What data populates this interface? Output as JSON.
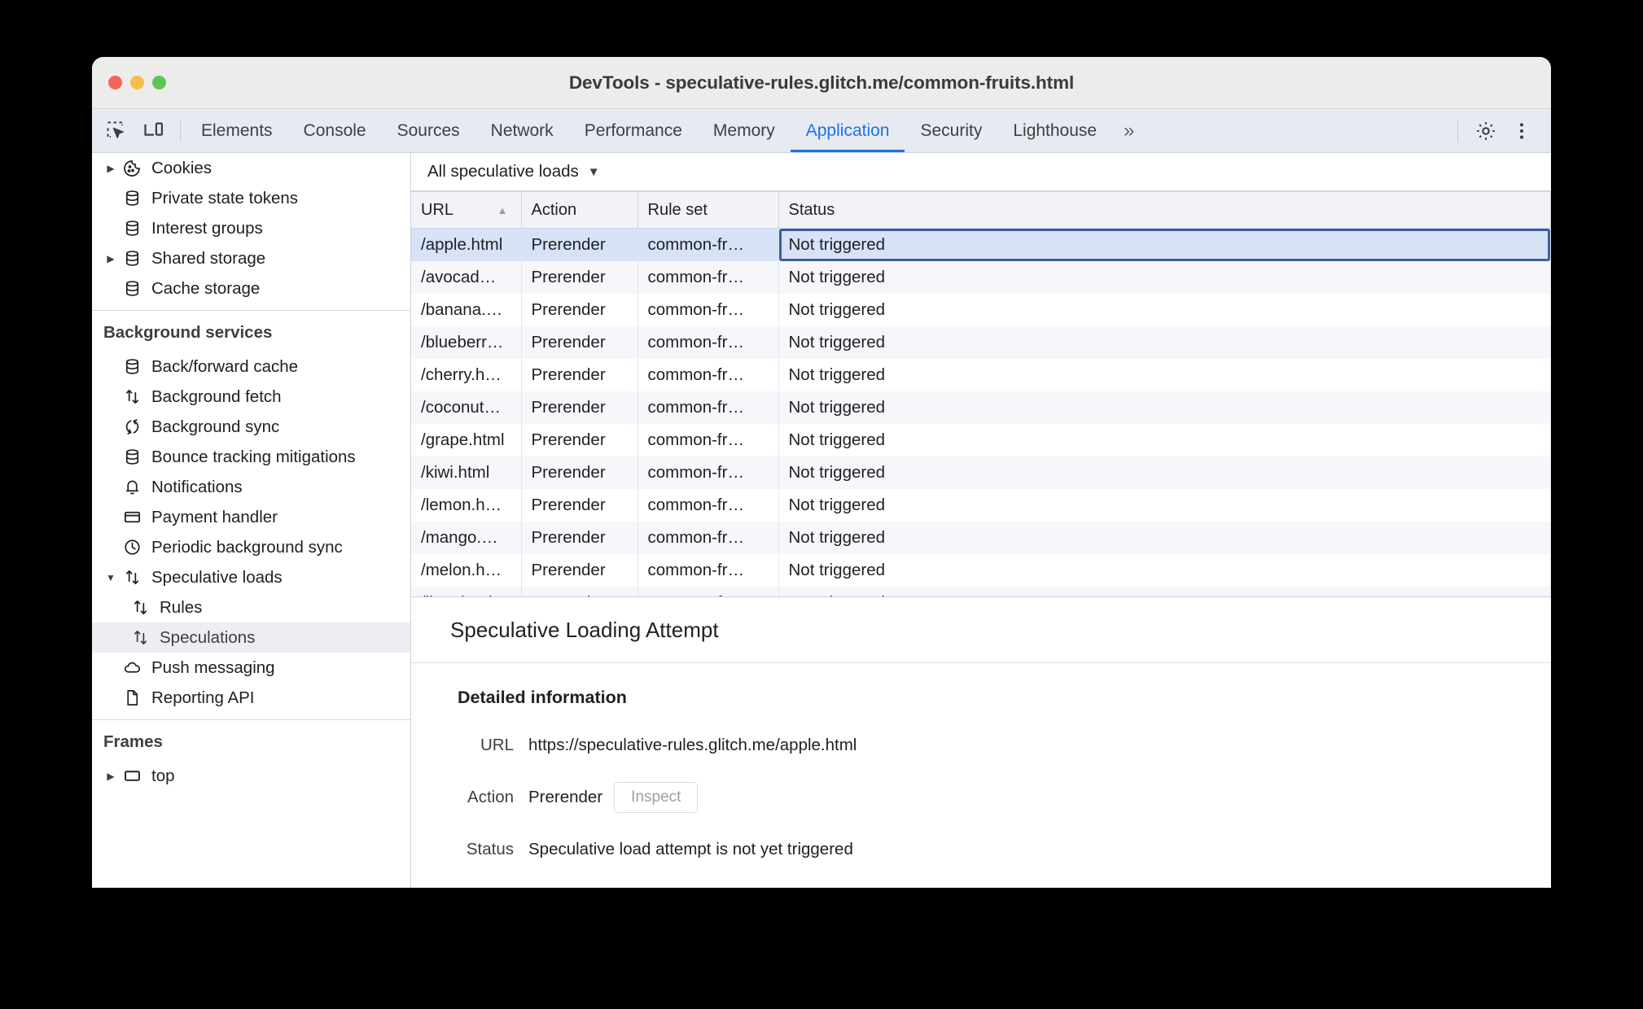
{
  "window": {
    "title": "DevTools - speculative-rules.glitch.me/common-fruits.html"
  },
  "toolbar": {
    "inspect_icon": "inspect-element-icon",
    "device_icon": "device-toolbar-icon",
    "settings_icon": "gear-icon",
    "more_icon": "more-vertical-icon",
    "overflow_label": "»"
  },
  "tabs": [
    {
      "label": "Elements",
      "active": false
    },
    {
      "label": "Console",
      "active": false
    },
    {
      "label": "Sources",
      "active": false
    },
    {
      "label": "Network",
      "active": false
    },
    {
      "label": "Performance",
      "active": false
    },
    {
      "label": "Memory",
      "active": false
    },
    {
      "label": "Application",
      "active": true
    },
    {
      "label": "Security",
      "active": false
    },
    {
      "label": "Lighthouse",
      "active": false
    }
  ],
  "sidebar": {
    "storage_items": [
      {
        "label": "Cookies",
        "icon": "cookie-icon",
        "twisty": true,
        "indent": 1
      },
      {
        "label": "Private state tokens",
        "icon": "database-icon",
        "twisty": false,
        "indent": 1
      },
      {
        "label": "Interest groups",
        "icon": "database-icon",
        "twisty": false,
        "indent": 1
      },
      {
        "label": "Shared storage",
        "icon": "database-icon",
        "twisty": true,
        "indent": 1
      },
      {
        "label": "Cache storage",
        "icon": "database-icon",
        "twisty": false,
        "indent": 1
      }
    ],
    "background_services_title": "Background services",
    "background_items": [
      {
        "label": "Back/forward cache",
        "icon": "database-icon",
        "twisty": false,
        "indent": 1,
        "selected": false
      },
      {
        "label": "Background fetch",
        "icon": "updown-arrows-icon",
        "twisty": false,
        "indent": 1,
        "selected": false
      },
      {
        "label": "Background sync",
        "icon": "sync-icon",
        "twisty": false,
        "indent": 1,
        "selected": false
      },
      {
        "label": "Bounce tracking mitigations",
        "icon": "database-icon",
        "twisty": false,
        "indent": 1,
        "selected": false
      },
      {
        "label": "Notifications",
        "icon": "bell-icon",
        "twisty": false,
        "indent": 1,
        "selected": false
      },
      {
        "label": "Payment handler",
        "icon": "credit-card-icon",
        "twisty": false,
        "indent": 1,
        "selected": false
      },
      {
        "label": "Periodic background sync",
        "icon": "clock-icon",
        "twisty": false,
        "indent": 1,
        "selected": false
      },
      {
        "label": "Speculative loads",
        "icon": "updown-arrows-icon",
        "twisty": true,
        "twisty_open": true,
        "indent": 1,
        "selected": false
      },
      {
        "label": "Rules",
        "icon": "updown-arrows-icon",
        "twisty": false,
        "indent": 2,
        "selected": false
      },
      {
        "label": "Speculations",
        "icon": "updown-arrows-icon",
        "twisty": false,
        "indent": 2,
        "selected": true
      },
      {
        "label": "Push messaging",
        "icon": "cloud-icon",
        "twisty": false,
        "indent": 1,
        "selected": false
      },
      {
        "label": "Reporting API",
        "icon": "document-icon",
        "twisty": false,
        "indent": 1,
        "selected": false
      }
    ],
    "frames_title": "Frames",
    "frames_items": [
      {
        "label": "top",
        "icon": "frame-icon",
        "twisty": true,
        "indent": 1
      }
    ]
  },
  "main": {
    "filter": {
      "selected": "All speculative loads",
      "caret": "▼"
    },
    "table": {
      "columns": [
        "URL",
        "Action",
        "Rule set",
        "Status"
      ],
      "sort_column": "URL",
      "sort_direction": "ascending",
      "sort_arrow": "▲",
      "rows": [
        {
          "url": "/apple.html",
          "action": "Prerender",
          "rule_set": "common-fr…",
          "status": "Not triggered",
          "selected": true
        },
        {
          "url": "/avocad…",
          "action": "Prerender",
          "rule_set": "common-fr…",
          "status": "Not triggered",
          "selected": false
        },
        {
          "url": "/banana.…",
          "action": "Prerender",
          "rule_set": "common-fr…",
          "status": "Not triggered",
          "selected": false
        },
        {
          "url": "/blueberr…",
          "action": "Prerender",
          "rule_set": "common-fr…",
          "status": "Not triggered",
          "selected": false
        },
        {
          "url": "/cherry.h…",
          "action": "Prerender",
          "rule_set": "common-fr…",
          "status": "Not triggered",
          "selected": false
        },
        {
          "url": "/coconut…",
          "action": "Prerender",
          "rule_set": "common-fr…",
          "status": "Not triggered",
          "selected": false
        },
        {
          "url": "/grape.html",
          "action": "Prerender",
          "rule_set": "common-fr…",
          "status": "Not triggered",
          "selected": false
        },
        {
          "url": "/kiwi.html",
          "action": "Prerender",
          "rule_set": "common-fr…",
          "status": "Not triggered",
          "selected": false
        },
        {
          "url": "/lemon.h…",
          "action": "Prerender",
          "rule_set": "common-fr…",
          "status": "Not triggered",
          "selected": false
        },
        {
          "url": "/mango.…",
          "action": "Prerender",
          "rule_set": "common-fr…",
          "status": "Not triggered",
          "selected": false
        },
        {
          "url": "/melon.h…",
          "action": "Prerender",
          "rule_set": "common-fr…",
          "status": "Not triggered",
          "selected": false
        },
        {
          "url": "/lime.html",
          "action": "Prerender",
          "rule_set": "common-fr…",
          "status": "Not triggered",
          "selected": false
        }
      ]
    }
  },
  "detail": {
    "header": "Speculative Loading Attempt",
    "section_title": "Detailed information",
    "url_label": "URL",
    "url_value": "https://speculative-rules.glitch.me/apple.html",
    "action_label": "Action",
    "action_value": "Prerender",
    "inspect_button": "Inspect",
    "status_label": "Status",
    "status_value": "Speculative load attempt is not yet triggered"
  },
  "colors": {
    "accent": "#1a73e8",
    "selection": "#d7e2f7",
    "focus_ring": "#3a5f9e",
    "tabstrip_bg": "#e8eaf2",
    "titlebar_bg": "#ececeb"
  }
}
